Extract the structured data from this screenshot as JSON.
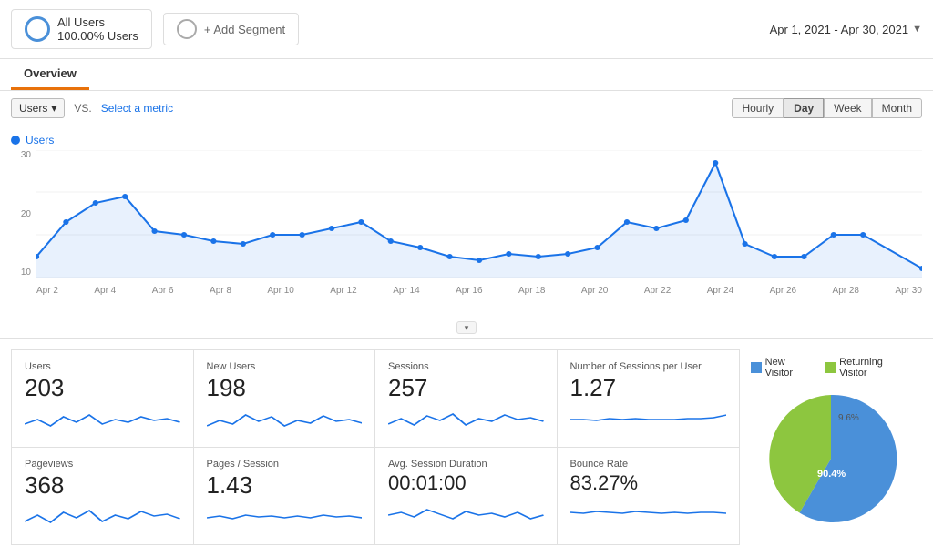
{
  "topbar": {
    "segment": {
      "name": "All Users",
      "sub": "100.00% Users"
    },
    "add_segment_label": "+ Add Segment",
    "date_range": "Apr 1, 2021 - Apr 30, 2021"
  },
  "tabs": {
    "overview_label": "Overview"
  },
  "chart_controls": {
    "metric_label": "Users",
    "vs_label": "VS.",
    "select_metric_label": "Select a metric",
    "time_buttons": [
      "Hourly",
      "Day",
      "Week",
      "Month"
    ],
    "active_time": "Day"
  },
  "chart": {
    "legend_label": "Users",
    "y_axis": [
      "30",
      "20",
      "10"
    ],
    "x_axis": [
      "Apr 2",
      "Apr 4",
      "Apr 6",
      "Apr 8",
      "Apr 10",
      "Apr 12",
      "Apr 14",
      "Apr 16",
      "Apr 18",
      "Apr 20",
      "Apr 22",
      "Apr 24",
      "Apr 26",
      "Apr 28",
      "Apr 30"
    ]
  },
  "metrics": [
    {
      "label": "Users",
      "value": "203"
    },
    {
      "label": "New Users",
      "value": "198"
    },
    {
      "label": "Sessions",
      "value": "257"
    },
    {
      "label": "Number of Sessions per User",
      "value": "1.27"
    },
    {
      "label": "Pageviews",
      "value": "368"
    },
    {
      "label": "Pages / Session",
      "value": "1.43"
    },
    {
      "label": "Avg. Session Duration",
      "value": "00:01:00"
    },
    {
      "label": "Bounce Rate",
      "value": "83.27%"
    }
  ],
  "pie": {
    "new_visitor_label": "New Visitor",
    "returning_visitor_label": "Returning Visitor",
    "new_visitor_pct": "90.4%",
    "returning_visitor_pct": "9.6%",
    "new_color": "#4a90d9",
    "returning_color": "#8dc63f"
  }
}
